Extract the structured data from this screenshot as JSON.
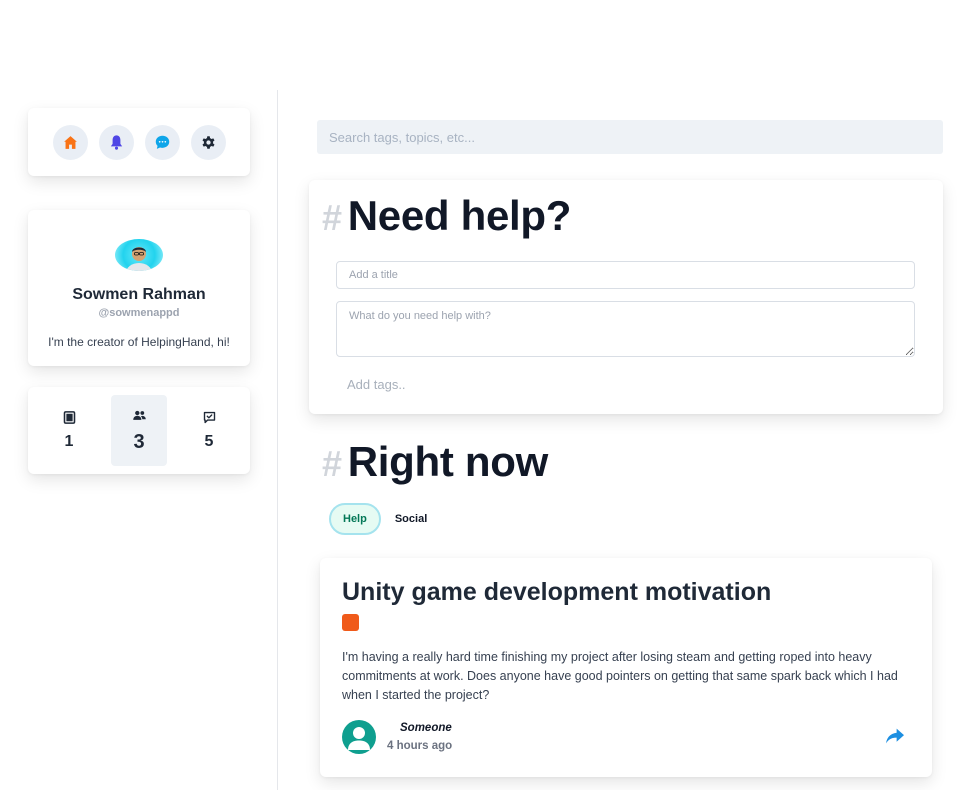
{
  "nav": {
    "items": [
      {
        "name": "home",
        "icon": "home-icon",
        "color": "#f97316"
      },
      {
        "name": "notifications",
        "icon": "bell-icon",
        "color": "#4f46e5"
      },
      {
        "name": "messages",
        "icon": "chat-icon",
        "color": "#0ea5e9"
      },
      {
        "name": "settings",
        "icon": "gear-icon",
        "color": "#1f2937"
      }
    ]
  },
  "profile": {
    "name": "Sowmen Rahman",
    "handle": "@sowmenappd",
    "bio": "I'm the creator of HelpingHand, hi!"
  },
  "stats": [
    {
      "icon": "square-icon",
      "value": "1",
      "active": false
    },
    {
      "icon": "users-icon",
      "value": "3",
      "active": true
    },
    {
      "icon": "message-check-icon",
      "value": "5",
      "active": false
    }
  ],
  "search": {
    "placeholder": "Search tags, topics, etc..."
  },
  "help": {
    "hash": "#",
    "heading": "Need help?",
    "title_placeholder": "Add a title",
    "description_placeholder": "What do you need help with?",
    "tags_placeholder": "Add tags.."
  },
  "right_now": {
    "hash": "#",
    "heading": "Right now",
    "tabs": [
      {
        "label": "Help",
        "active": true
      },
      {
        "label": "Social",
        "active": false
      }
    ]
  },
  "post": {
    "title": "Unity game development motivation",
    "tag_color": "#f05a1a",
    "body": "I'm having a really hard time finishing my project after losing steam and getting roped into heavy commitments at work. Does anyone have good pointers on getting that same spark back which I had when I started the project?",
    "author": "Someone",
    "time": "4 hours ago",
    "share_icon": "share-icon"
  },
  "colors": {
    "accent_teal": "#0f9f8f",
    "help_tab_text": "#047857",
    "share_blue": "#1d8fe1"
  }
}
